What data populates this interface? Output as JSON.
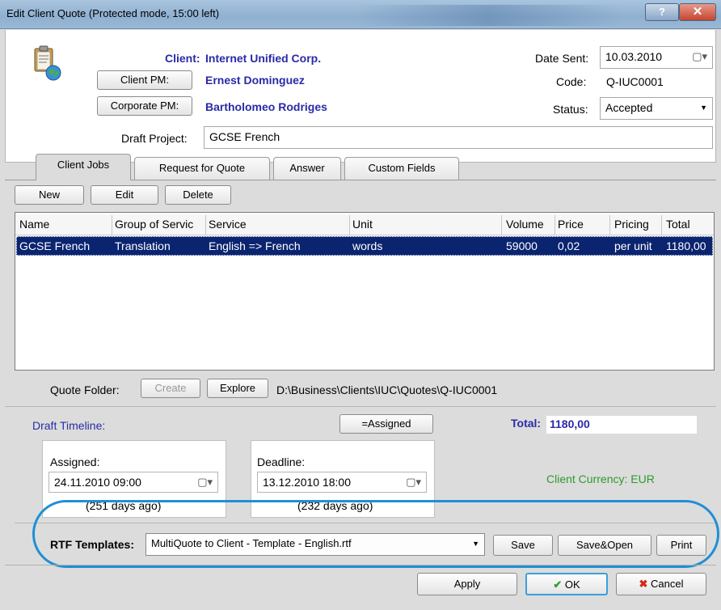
{
  "window": {
    "title": "Edit Client Quote (Protected mode, 15:00 left)",
    "help_label": "?",
    "close_label": "x"
  },
  "header": {
    "client_label": "Client:",
    "client_value": "Internet Unified Corp.",
    "client_pm_button": "Client PM:",
    "client_pm_value": "Ernest Dominguez",
    "corporate_pm_button": "Corporate PM:",
    "corporate_pm_value": "Bartholomeo Rodriges",
    "draft_project_label": "Draft Project:",
    "draft_project_value": "GCSE French",
    "date_sent_label": "Date Sent:",
    "date_sent_value": "10.03.2010",
    "code_label": "Code:",
    "code_value": "Q-IUC0001",
    "status_label": "Status:",
    "status_value": "Accepted"
  },
  "tabs": [
    {
      "label": "Client Jobs",
      "active": true
    },
    {
      "label": "Request for Quote",
      "active": false
    },
    {
      "label": "Answer",
      "active": false
    },
    {
      "label": "Custom Fields",
      "active": false
    }
  ],
  "toolbar": {
    "new_label": "New",
    "edit_label": "Edit",
    "delete_label": "Delete"
  },
  "grid": {
    "columns": [
      "Name",
      "Group of Servic",
      "Service",
      "Unit",
      "Volume",
      "Price",
      "Pricing",
      "Total"
    ],
    "rows": [
      [
        "GCSE French",
        "Translation",
        "English => French",
        "words",
        "59000",
        "0,02",
        "per unit",
        "1180,00"
      ]
    ]
  },
  "quote_folder": {
    "label": "Quote Folder:",
    "create_label": "Create",
    "explore_label": "Explore",
    "path": "D:\\Business\\Clients\\IUC\\Quotes\\Q-IUC0001"
  },
  "timeline": {
    "title": "Draft Timeline:",
    "assigned_button": "=Assigned",
    "total_label": "Total:",
    "total_value": "1180,00",
    "assigned_label": "Assigned:",
    "assigned_value": "24.11.2010 09:00",
    "assigned_ago": "(251 days ago)",
    "deadline_label": "Deadline:",
    "deadline_value": "13.12.2010 18:00",
    "deadline_ago": "(232 days ago)",
    "currency_label": "Client Currency: EUR"
  },
  "rtf": {
    "label": "RTF Templates:",
    "template_value": "MultiQuote to Client - Template - English.rtf",
    "save_label": "Save",
    "save_open_label": "Save&Open",
    "print_label": "Print"
  },
  "footer": {
    "apply_label": "Apply",
    "ok_label": "OK",
    "cancel_label": "Cancel"
  },
  "colors": {
    "selection": "#0a2470",
    "link_blue": "#2a2aa8",
    "currency_green": "#2e9a2e",
    "highlight_ellipse": "#1f8fd6"
  }
}
